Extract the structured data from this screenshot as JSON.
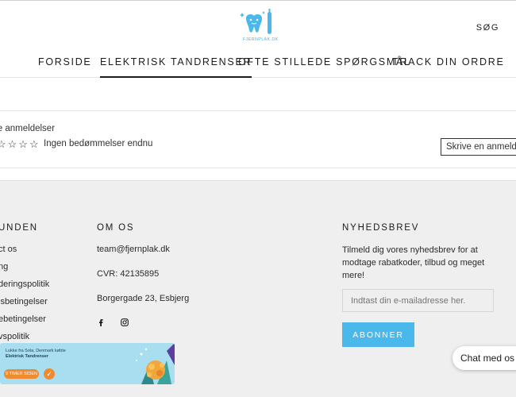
{
  "header": {
    "logo_text": "FJERNPLAK.DK",
    "search_label": "SØG",
    "nav": [
      {
        "label": "FORSIDE"
      },
      {
        "label": "ELEKTRISK TANDRENSER"
      },
      {
        "label": "OFTE STILLEDE SPØRGSMÅL"
      },
      {
        "label": "TRACK DIN ORDRE"
      }
    ],
    "active_nav": "ELEKTRISK TANDRENSER"
  },
  "reviews": {
    "title": "nde anmeldelser",
    "stars": "☆☆☆☆",
    "no_ratings": "Ingen bedømmelser endnu",
    "write_review": "Skrive en anmelde"
  },
  "footer": {
    "col1": {
      "title": "UNDEN",
      "links": [
        "ct os",
        "ng",
        "deringspolitik",
        "lsbetingelser",
        "ebetingelser",
        "vspolitik"
      ]
    },
    "col2": {
      "title": "OM OS",
      "email": "team@fjernplak.dk",
      "cvr": "CVR: 42135895",
      "address": "Borgergade 23, Esbjerg",
      "social": [
        "facebook-icon",
        "instagram-icon"
      ]
    },
    "col3": {
      "title": "NYHEDSBREV",
      "text": "Tilmeld dig vores nyhedsbrev for at modtage rabatkoder, tilbud og meget mere!",
      "email_placeholder": "Indtast din e-mailadresse her.",
      "subscribe": "ABONNER"
    }
  },
  "promo": {
    "line1": "Lukke fra Sola, Denmark købte",
    "line2": "Elektrisk Tandrenser",
    "time": "9 TIMER SIDEN"
  },
  "chat": {
    "label": "Chat med os"
  },
  "colors": {
    "accent": "#4bb8ec",
    "footer_bg": "#efefef",
    "promo_bg": "#a9def0",
    "promo_orange": "#f08a2e"
  }
}
